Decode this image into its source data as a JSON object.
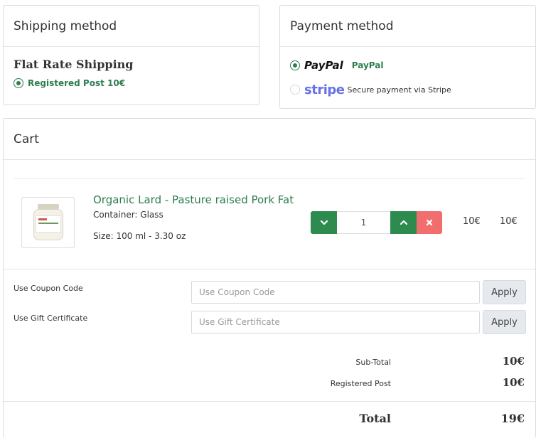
{
  "shipping": {
    "title": "Shipping method",
    "method_name": "Flat Rate Shipping",
    "option_label": "Registered Post 10€"
  },
  "payment": {
    "title": "Payment method",
    "options": [
      {
        "logo": "PayPal",
        "label": "PayPal",
        "selected": true
      },
      {
        "logo": "stripe",
        "label": "Secure payment via Stripe",
        "selected": false
      }
    ]
  },
  "cart": {
    "title": "Cart",
    "item": {
      "name": "Organic Lard - Pasture raised Pork Fat",
      "container": "Container: Glass",
      "size": "Size: 100 ml - 3.30 oz",
      "quantity": "1",
      "unit_price": "10€",
      "total_price": "10€"
    },
    "coupon": {
      "label": "Use Coupon Code",
      "placeholder": "Use Coupon Code",
      "button": "Apply"
    },
    "gift": {
      "label": "Use Gift Certificate",
      "placeholder": "Use Gift Certificate",
      "button": "Apply"
    },
    "totals": {
      "subtotal_label": "Sub-Total",
      "subtotal_value": "10€",
      "shipping_label": "Registered Post",
      "shipping_value": "10€",
      "total_label": "Total",
      "total_value": "19€"
    }
  },
  "colors": {
    "brand_green": "#2e7d4f",
    "button_green": "#2e8b50",
    "remove_red": "#f26d6d",
    "stripe_purple": "#6772e5"
  }
}
